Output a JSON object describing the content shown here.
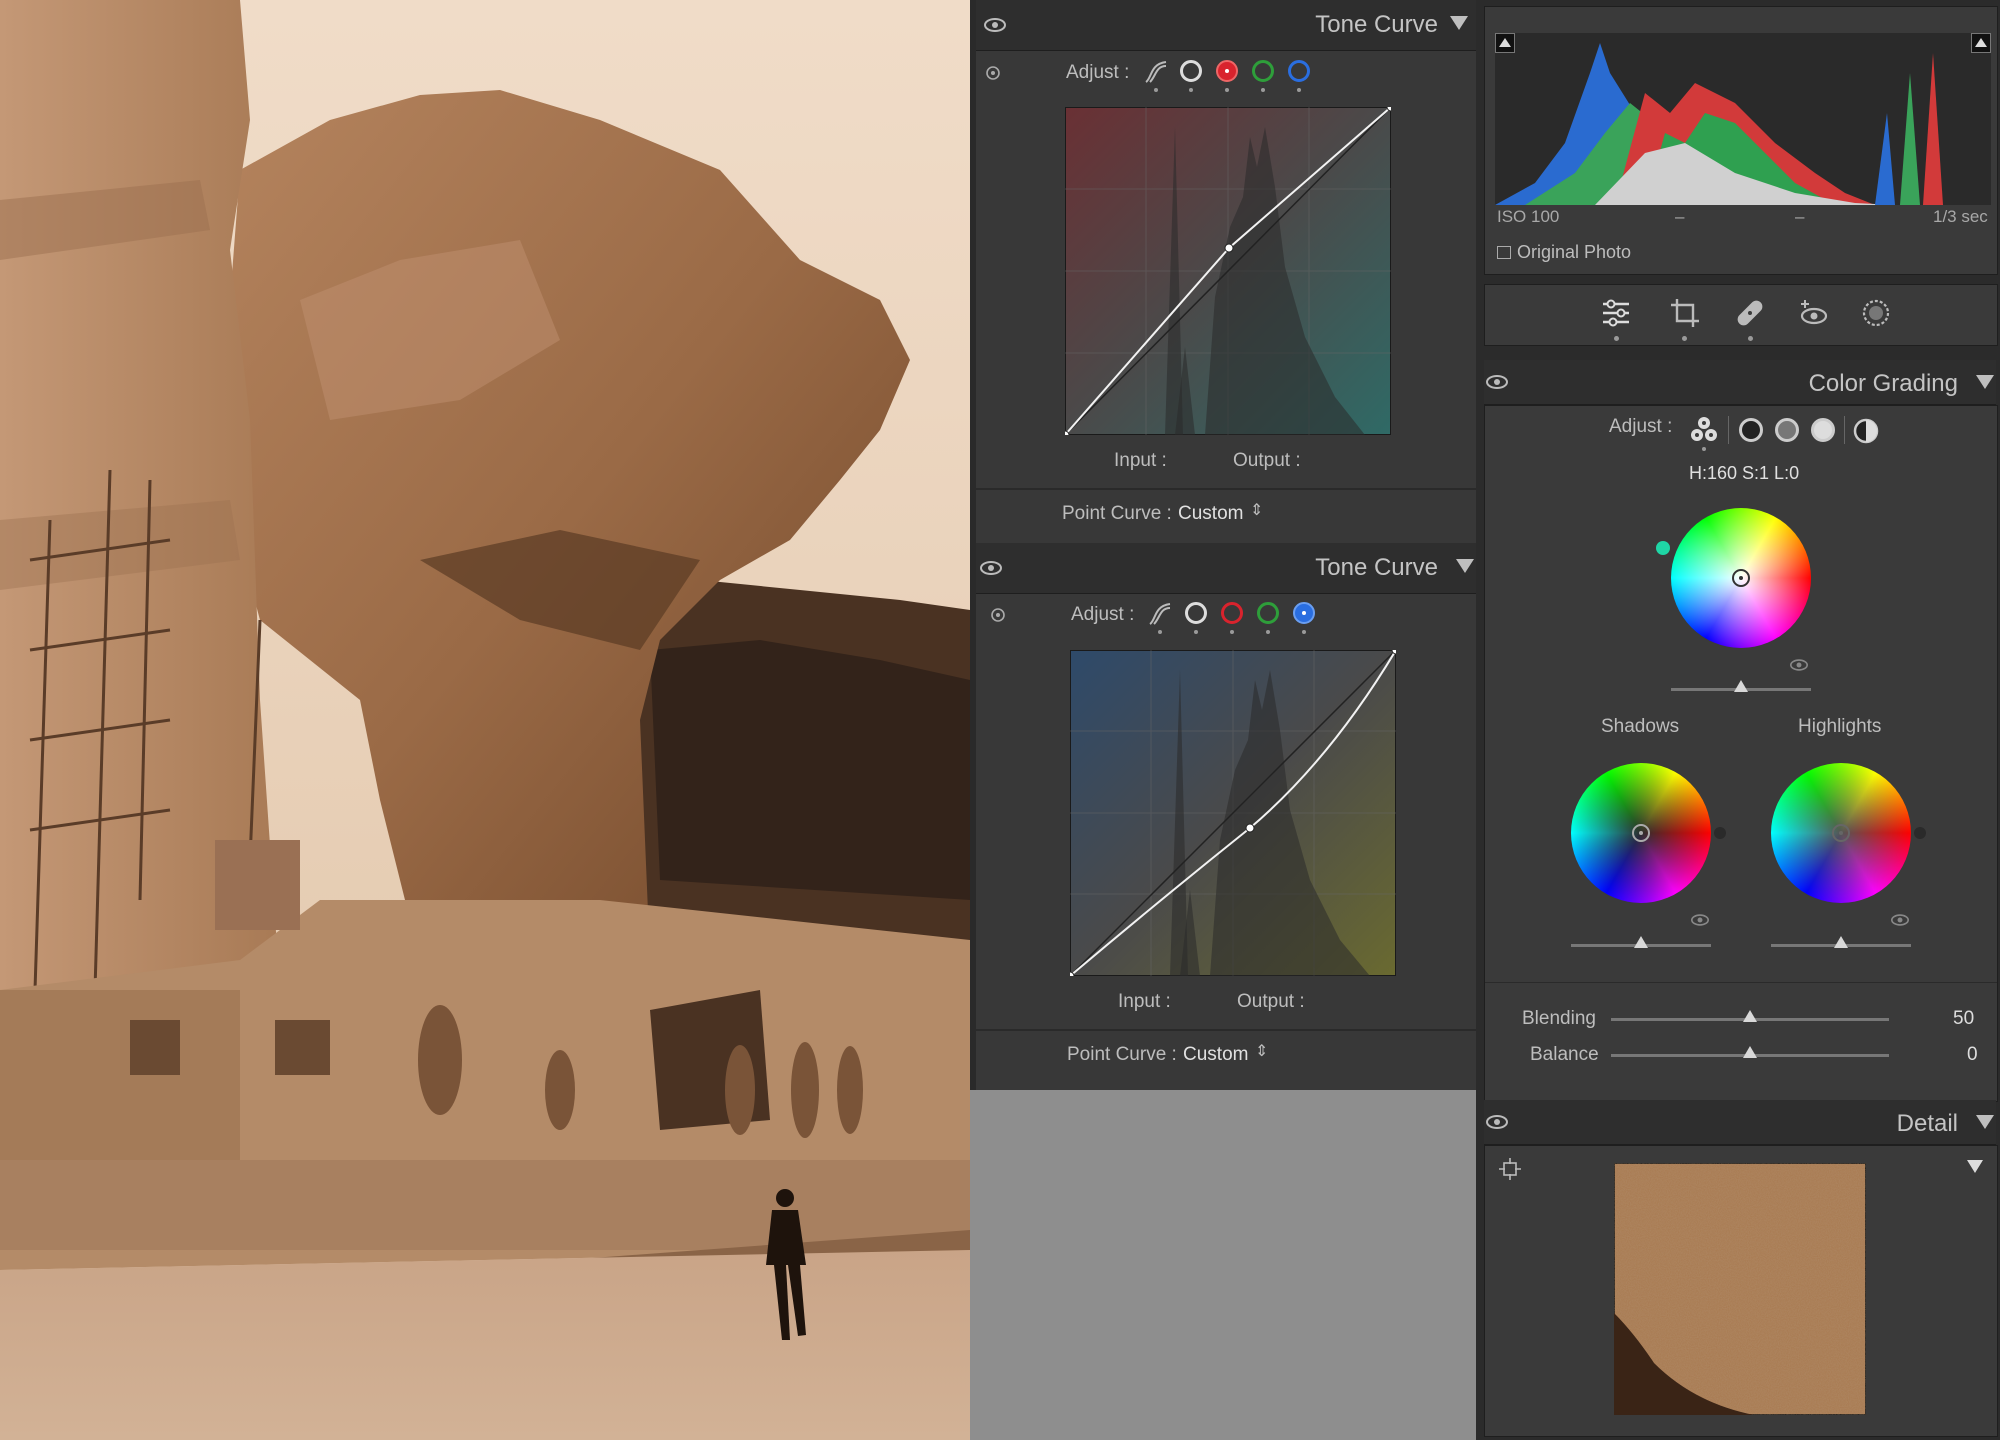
{
  "tone_curve_1": {
    "title": "Tone Curve",
    "adjust_label": "Adjust :",
    "input_label": "Input :",
    "output_label": "Output :",
    "point_curve_label": "Point Curve :",
    "point_curve_value": "Custom",
    "active_channel": "red"
  },
  "tone_curve_2": {
    "title": "Tone Curve",
    "adjust_label": "Adjust :",
    "input_label": "Input :",
    "output_label": "Output :",
    "point_curve_label": "Point Curve :",
    "point_curve_value": "Custom",
    "active_channel": "blue"
  },
  "histogram": {
    "iso": "ISO 100",
    "dash1": "–",
    "dash2": "–",
    "shutter": "1/3 sec",
    "original_photo_label": "Original Photo"
  },
  "color_grading": {
    "title": "Color Grading",
    "adjust_label": "Adjust :",
    "hsl_readout": "H:160 S:1 L:0",
    "shadows_label": "Shadows",
    "highlights_label": "Highlights",
    "blending_label": "Blending",
    "blending_value": "50",
    "balance_label": "Balance",
    "balance_value": "0"
  },
  "detail": {
    "title": "Detail"
  },
  "colors": {
    "panel": "#3c3c3c",
    "header": "#2e2e2e",
    "red_channel": "#d9232d",
    "green_channel": "#2e9e3a",
    "blue_channel": "#2a6ee0"
  }
}
